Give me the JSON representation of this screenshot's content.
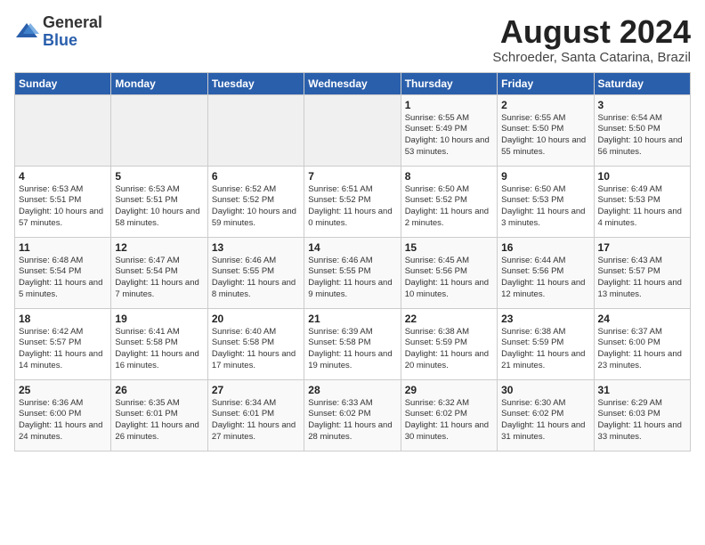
{
  "header": {
    "logo_general": "General",
    "logo_blue": "Blue",
    "title": "August 2024",
    "subtitle": "Schroeder, Santa Catarina, Brazil"
  },
  "weekdays": [
    "Sunday",
    "Monday",
    "Tuesday",
    "Wednesday",
    "Thursday",
    "Friday",
    "Saturday"
  ],
  "weeks": [
    [
      {
        "day": "",
        "info": ""
      },
      {
        "day": "",
        "info": ""
      },
      {
        "day": "",
        "info": ""
      },
      {
        "day": "",
        "info": ""
      },
      {
        "day": "1",
        "info": "Sunrise: 6:55 AM\nSunset: 5:49 PM\nDaylight: 10 hours and 53 minutes."
      },
      {
        "day": "2",
        "info": "Sunrise: 6:55 AM\nSunset: 5:50 PM\nDaylight: 10 hours and 55 minutes."
      },
      {
        "day": "3",
        "info": "Sunrise: 6:54 AM\nSunset: 5:50 PM\nDaylight: 10 hours and 56 minutes."
      }
    ],
    [
      {
        "day": "4",
        "info": "Sunrise: 6:53 AM\nSunset: 5:51 PM\nDaylight: 10 hours and 57 minutes."
      },
      {
        "day": "5",
        "info": "Sunrise: 6:53 AM\nSunset: 5:51 PM\nDaylight: 10 hours and 58 minutes."
      },
      {
        "day": "6",
        "info": "Sunrise: 6:52 AM\nSunset: 5:52 PM\nDaylight: 10 hours and 59 minutes."
      },
      {
        "day": "7",
        "info": "Sunrise: 6:51 AM\nSunset: 5:52 PM\nDaylight: 11 hours and 0 minutes."
      },
      {
        "day": "8",
        "info": "Sunrise: 6:50 AM\nSunset: 5:52 PM\nDaylight: 11 hours and 2 minutes."
      },
      {
        "day": "9",
        "info": "Sunrise: 6:50 AM\nSunset: 5:53 PM\nDaylight: 11 hours and 3 minutes."
      },
      {
        "day": "10",
        "info": "Sunrise: 6:49 AM\nSunset: 5:53 PM\nDaylight: 11 hours and 4 minutes."
      }
    ],
    [
      {
        "day": "11",
        "info": "Sunrise: 6:48 AM\nSunset: 5:54 PM\nDaylight: 11 hours and 5 minutes."
      },
      {
        "day": "12",
        "info": "Sunrise: 6:47 AM\nSunset: 5:54 PM\nDaylight: 11 hours and 7 minutes."
      },
      {
        "day": "13",
        "info": "Sunrise: 6:46 AM\nSunset: 5:55 PM\nDaylight: 11 hours and 8 minutes."
      },
      {
        "day": "14",
        "info": "Sunrise: 6:46 AM\nSunset: 5:55 PM\nDaylight: 11 hours and 9 minutes."
      },
      {
        "day": "15",
        "info": "Sunrise: 6:45 AM\nSunset: 5:56 PM\nDaylight: 11 hours and 10 minutes."
      },
      {
        "day": "16",
        "info": "Sunrise: 6:44 AM\nSunset: 5:56 PM\nDaylight: 11 hours and 12 minutes."
      },
      {
        "day": "17",
        "info": "Sunrise: 6:43 AM\nSunset: 5:57 PM\nDaylight: 11 hours and 13 minutes."
      }
    ],
    [
      {
        "day": "18",
        "info": "Sunrise: 6:42 AM\nSunset: 5:57 PM\nDaylight: 11 hours and 14 minutes."
      },
      {
        "day": "19",
        "info": "Sunrise: 6:41 AM\nSunset: 5:58 PM\nDaylight: 11 hours and 16 minutes."
      },
      {
        "day": "20",
        "info": "Sunrise: 6:40 AM\nSunset: 5:58 PM\nDaylight: 11 hours and 17 minutes."
      },
      {
        "day": "21",
        "info": "Sunrise: 6:39 AM\nSunset: 5:58 PM\nDaylight: 11 hours and 19 minutes."
      },
      {
        "day": "22",
        "info": "Sunrise: 6:38 AM\nSunset: 5:59 PM\nDaylight: 11 hours and 20 minutes."
      },
      {
        "day": "23",
        "info": "Sunrise: 6:38 AM\nSunset: 5:59 PM\nDaylight: 11 hours and 21 minutes."
      },
      {
        "day": "24",
        "info": "Sunrise: 6:37 AM\nSunset: 6:00 PM\nDaylight: 11 hours and 23 minutes."
      }
    ],
    [
      {
        "day": "25",
        "info": "Sunrise: 6:36 AM\nSunset: 6:00 PM\nDaylight: 11 hours and 24 minutes."
      },
      {
        "day": "26",
        "info": "Sunrise: 6:35 AM\nSunset: 6:01 PM\nDaylight: 11 hours and 26 minutes."
      },
      {
        "day": "27",
        "info": "Sunrise: 6:34 AM\nSunset: 6:01 PM\nDaylight: 11 hours and 27 minutes."
      },
      {
        "day": "28",
        "info": "Sunrise: 6:33 AM\nSunset: 6:02 PM\nDaylight: 11 hours and 28 minutes."
      },
      {
        "day": "29",
        "info": "Sunrise: 6:32 AM\nSunset: 6:02 PM\nDaylight: 11 hours and 30 minutes."
      },
      {
        "day": "30",
        "info": "Sunrise: 6:30 AM\nSunset: 6:02 PM\nDaylight: 11 hours and 31 minutes."
      },
      {
        "day": "31",
        "info": "Sunrise: 6:29 AM\nSunset: 6:03 PM\nDaylight: 11 hours and 33 minutes."
      }
    ]
  ]
}
